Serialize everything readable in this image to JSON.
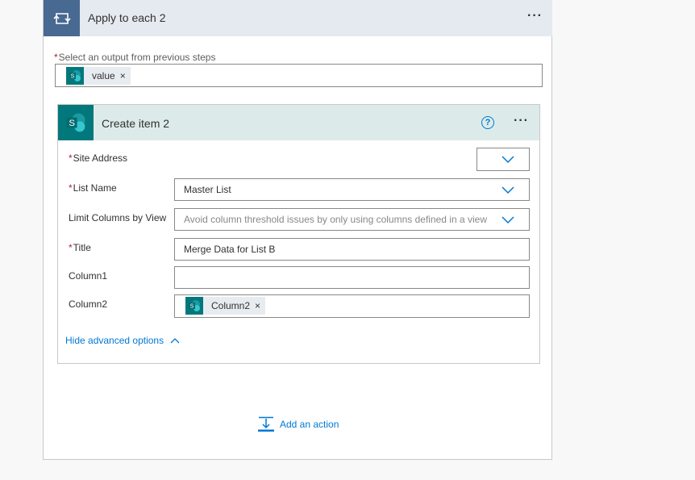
{
  "loop": {
    "title": "Apply to each 2",
    "more_label": "···",
    "output_label": "Select an output from previous steps",
    "output_token": "value",
    "token_remove": "×"
  },
  "action": {
    "title": "Create item 2",
    "help_label": "?",
    "more_label": "···",
    "fields": {
      "site_address": {
        "label": "Site Address",
        "value": ""
      },
      "list_name": {
        "label": "List Name",
        "value": "Master List"
      },
      "limit_columns": {
        "label": "Limit Columns by View",
        "placeholder": "Avoid column threshold issues by only using columns defined in a view"
      },
      "title": {
        "label": "Title",
        "value": "Merge Data for List B"
      },
      "column1": {
        "label": "Column1",
        "value": ""
      },
      "column2": {
        "label": "Column2",
        "token": "Column2"
      }
    },
    "required_mark": "*",
    "advanced_toggle": "Hide advanced options"
  },
  "footer": {
    "add_action": "Add an action"
  },
  "colors": {
    "loop_accent": "#486991",
    "sharepoint": "#03787c",
    "link": "#0078d4",
    "required": "#a4262c"
  },
  "icons": [
    "loop-icon",
    "sharepoint-icon",
    "help-icon",
    "chevron-down-icon",
    "chevron-up-icon",
    "add-action-icon",
    "close-icon"
  ]
}
